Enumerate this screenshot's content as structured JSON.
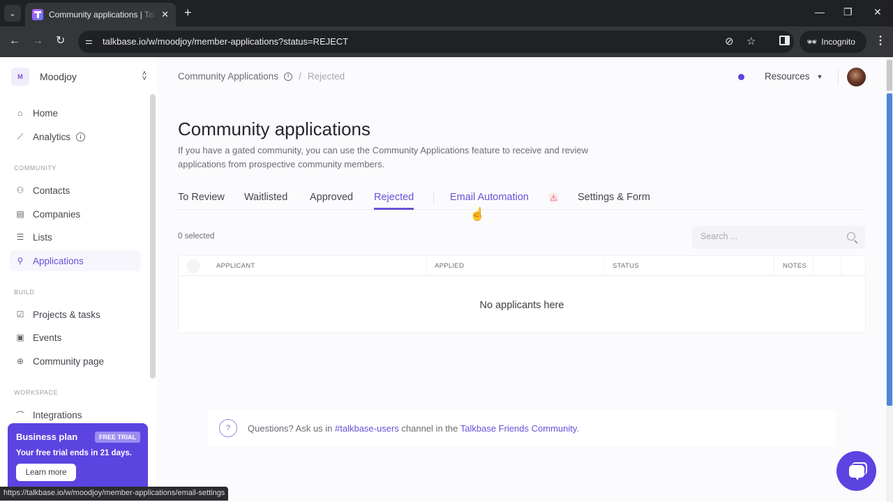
{
  "browser": {
    "tab_title": "Community applications | Talkbase",
    "url": "talkbase.io/w/moodjoy/member-applications?status=REJECT",
    "profile_label": "Incognito",
    "status_url": "https://talkbase.io/w/moodjoy/member-applications/email-settings"
  },
  "sidebar": {
    "workspace": {
      "initial": "M",
      "name": "Moodjoy"
    },
    "top_items": [
      {
        "label": "Home",
        "icon": "home-icon"
      },
      {
        "label": "Analytics",
        "icon": "chart-icon",
        "has_info": true
      }
    ],
    "sections": [
      {
        "label": "COMMUNITY",
        "items": [
          {
            "label": "Contacts",
            "icon": "users-icon"
          },
          {
            "label": "Companies",
            "icon": "building-icon"
          },
          {
            "label": "Lists",
            "icon": "list-icon"
          },
          {
            "label": "Applications",
            "icon": "user-plus-icon",
            "active": true
          }
        ]
      },
      {
        "label": "BUILD",
        "items": [
          {
            "label": "Projects & tasks",
            "icon": "task-icon"
          },
          {
            "label": "Events",
            "icon": "calendar-icon"
          },
          {
            "label": "Community page",
            "icon": "globe-icon"
          }
        ]
      },
      {
        "label": "WORKSPACE",
        "items": [
          {
            "label": "Integrations",
            "icon": "plug-icon"
          }
        ]
      }
    ],
    "plan_card": {
      "title": "Business plan",
      "badge": "FREE TRIAL",
      "text": "Your free trial ends in 21 days.",
      "button": "Learn more"
    }
  },
  "header": {
    "breadcrumb": [
      "Community Applications",
      "Rejected"
    ],
    "resources_label": "Resources"
  },
  "main": {
    "title": "Community applications",
    "description": "If you have a gated community, you can use the Community Applications feature to receive and review applications from prospective community members.",
    "tabs": [
      {
        "label": "To Review"
      },
      {
        "label": "Waitlisted"
      },
      {
        "label": "Approved"
      },
      {
        "label": "Rejected",
        "active": true
      },
      {
        "label": "Email Automation",
        "warning": true
      },
      {
        "label": "Settings & Form"
      }
    ],
    "selected_count": "0 selected",
    "search_placeholder": "Search ...",
    "table": {
      "columns": [
        "APPLICANT",
        "APPLIED",
        "STATUS",
        "NOTES"
      ],
      "rows": [],
      "empty_message": "No applicants here"
    },
    "help": {
      "prefix": "Questions? Ask us in ",
      "channel_link": "#talkbase-users",
      "middle": " channel in the ",
      "community_link": "Talkbase Friends Community",
      "suffix": "."
    }
  },
  "colors": {
    "accent": "#6a4fd6",
    "brand": "#5b44e0",
    "warning": "#e04d5a"
  }
}
